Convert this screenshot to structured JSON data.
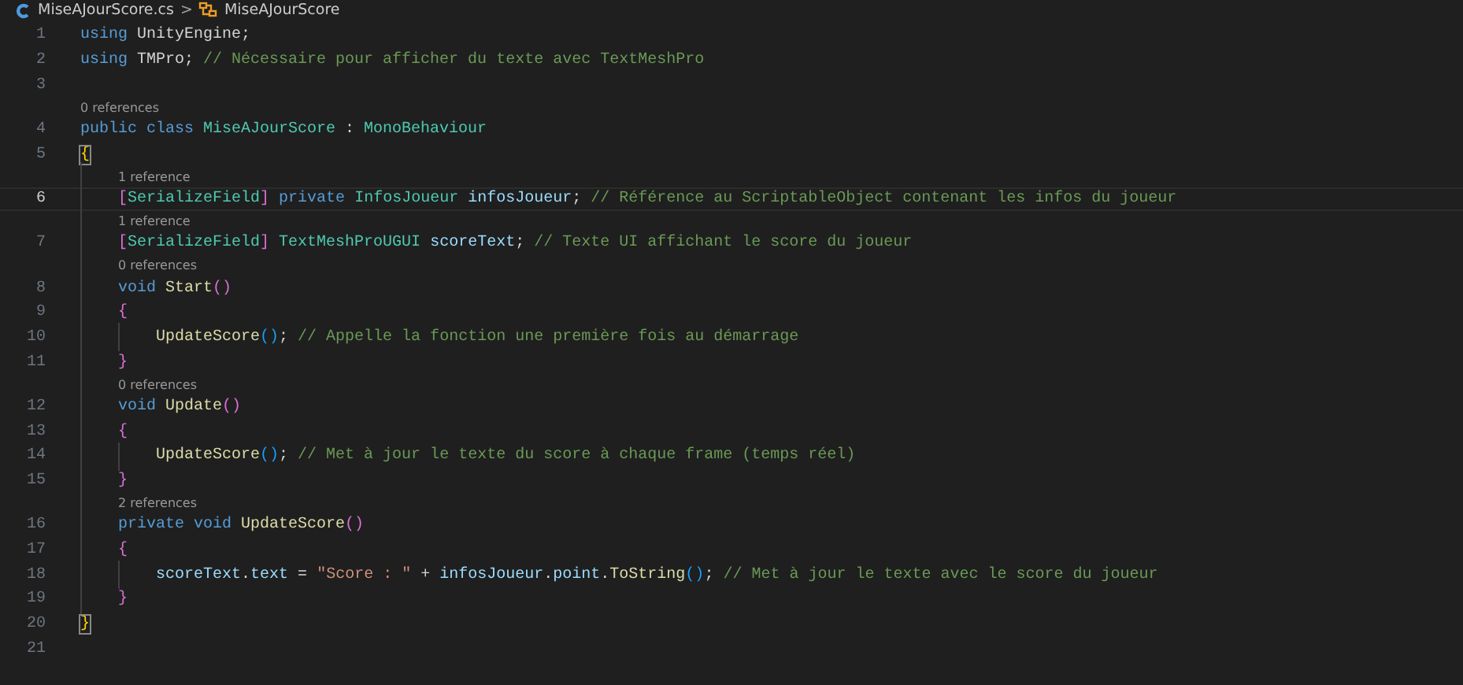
{
  "breadcrumb": {
    "file": "MiseAJourScore.cs",
    "separator": ">",
    "symbol": "MiseAJourScore"
  },
  "lines": [
    {
      "number": "1",
      "current": false,
      "tokens": [
        {
          "kind": "kw",
          "text": "using"
        },
        {
          "kind": "plain",
          "text": " UnityEngine;"
        }
      ]
    },
    {
      "number": "2",
      "current": false,
      "tokens": [
        {
          "kind": "kw",
          "text": "using"
        },
        {
          "kind": "plain",
          "text": " TMPro;"
        },
        {
          "kind": "comment",
          "text": " // Nécessaire pour afficher du texte avec TextMeshPro"
        }
      ]
    },
    {
      "number": "3",
      "current": false
    },
    {
      "number": "4",
      "current": false,
      "codelens": "0 references",
      "tokens": [
        {
          "kind": "kw",
          "text": "public class"
        },
        {
          "kind": "type",
          "text": " MiseAJourScore"
        },
        {
          "kind": "plain",
          "text": " : "
        },
        {
          "kind": "type",
          "text": "MonoBehaviour"
        }
      ]
    },
    {
      "number": "5",
      "current": false,
      "tokens": [
        {
          "kind": "bracket-match",
          "text": "{"
        }
      ]
    },
    {
      "number": "6",
      "current": true,
      "codelens": "1 reference",
      "tokens": [
        {
          "kind": "bracket2",
          "text": "    ["
        },
        {
          "kind": "type",
          "text": "SerializeField"
        },
        {
          "kind": "bracket2",
          "text": "]"
        },
        {
          "kind": "kw",
          "text": " private"
        },
        {
          "kind": "type",
          "text": " InfosJoueur"
        },
        {
          "kind": "var",
          "text": " infosJoueur"
        },
        {
          "kind": "plain",
          "text": ";"
        },
        {
          "kind": "comment",
          "text": " // Référence au ScriptableObject contenant les infos du joueur"
        }
      ]
    },
    {
      "number": "7",
      "current": false,
      "codelens": "1 reference",
      "tokens": [
        {
          "kind": "bracket2",
          "text": "    ["
        },
        {
          "kind": "type",
          "text": "SerializeField"
        },
        {
          "kind": "bracket2",
          "text": "]"
        },
        {
          "kind": "type",
          "text": " TextMeshProUGUI"
        },
        {
          "kind": "var",
          "text": " scoreText"
        },
        {
          "kind": "plain",
          "text": ";"
        },
        {
          "kind": "comment",
          "text": " // Texte UI affichant le score du joueur"
        }
      ]
    },
    {
      "number": "8",
      "current": false,
      "codelens": "0 references",
      "tokens": [
        {
          "kind": "kw",
          "text": "    void"
        },
        {
          "kind": "fn",
          "text": " Start"
        },
        {
          "kind": "bracket2",
          "text": "()"
        }
      ]
    },
    {
      "number": "9",
      "current": false,
      "tokens": [
        {
          "kind": "bracket2",
          "text": "    {"
        }
      ]
    },
    {
      "number": "10",
      "current": false,
      "tokens": [
        {
          "kind": "fn",
          "text": "        UpdateScore"
        },
        {
          "kind": "bracket3",
          "text": "()"
        },
        {
          "kind": "plain",
          "text": ";"
        },
        {
          "kind": "comment",
          "text": " // Appelle la fonction une première fois au démarrage"
        }
      ]
    },
    {
      "number": "11",
      "current": false,
      "tokens": [
        {
          "kind": "bracket2",
          "text": "    }"
        }
      ]
    },
    {
      "number": "12",
      "current": false,
      "codelens": "0 references",
      "tokens": [
        {
          "kind": "kw",
          "text": "    void"
        },
        {
          "kind": "fn",
          "text": " Update"
        },
        {
          "kind": "bracket2",
          "text": "()"
        }
      ]
    },
    {
      "number": "13",
      "current": false,
      "tokens": [
        {
          "kind": "bracket2",
          "text": "    {"
        }
      ]
    },
    {
      "number": "14",
      "current": false,
      "tokens": [
        {
          "kind": "fn",
          "text": "        UpdateScore"
        },
        {
          "kind": "bracket3",
          "text": "()"
        },
        {
          "kind": "plain",
          "text": ";"
        },
        {
          "kind": "comment",
          "text": " // Met à jour le texte du score à chaque frame (temps réel)"
        }
      ]
    },
    {
      "number": "15",
      "current": false,
      "tokens": [
        {
          "kind": "bracket2",
          "text": "    }"
        }
      ]
    },
    {
      "number": "16",
      "current": false,
      "codelens": "2 references",
      "tokens": [
        {
          "kind": "kw",
          "text": "    private void"
        },
        {
          "kind": "fn",
          "text": " UpdateScore"
        },
        {
          "kind": "bracket2",
          "text": "()"
        }
      ]
    },
    {
      "number": "17",
      "current": false,
      "tokens": [
        {
          "kind": "bracket2",
          "text": "    {"
        }
      ]
    },
    {
      "number": "18",
      "current": false,
      "tokens": [
        {
          "kind": "var",
          "text": "        scoreText"
        },
        {
          "kind": "plain",
          "text": "."
        },
        {
          "kind": "var",
          "text": "text"
        },
        {
          "kind": "plain",
          "text": " = "
        },
        {
          "kind": "str",
          "text": "\"Score : \""
        },
        {
          "kind": "plain",
          "text": " + "
        },
        {
          "kind": "var",
          "text": "infosJoueur"
        },
        {
          "kind": "plain",
          "text": "."
        },
        {
          "kind": "var",
          "text": "point"
        },
        {
          "kind": "plain",
          "text": "."
        },
        {
          "kind": "fn",
          "text": "ToString"
        },
        {
          "kind": "bracket3",
          "text": "()"
        },
        {
          "kind": "plain",
          "text": ";"
        },
        {
          "kind": "comment",
          "text": " // Met à jour le texte avec le score du joueur"
        }
      ]
    },
    {
      "number": "19",
      "current": false,
      "tokens": [
        {
          "kind": "bracket2",
          "text": "    }"
        }
      ]
    },
    {
      "number": "20",
      "current": false,
      "tokens": [
        {
          "kind": "bracket-match",
          "text": "}"
        }
      ]
    },
    {
      "number": "21",
      "current": false
    }
  ]
}
